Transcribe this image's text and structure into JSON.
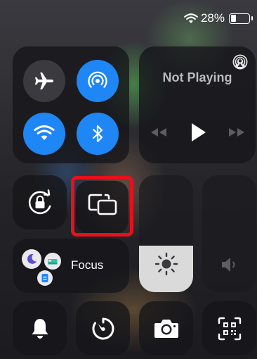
{
  "status_bar": {
    "battery_text": "28%",
    "icons": [
      "wifi-icon",
      "battery-icon"
    ]
  },
  "connectivity": {
    "airplane": {
      "icon": "airplane-icon",
      "on": false
    },
    "airdrop": {
      "icon": "airdrop-icon",
      "on": true
    },
    "wifi": {
      "icon": "wifi-icon",
      "on": true
    },
    "bluetooth": {
      "icon": "bluetooth-icon",
      "on": true
    }
  },
  "now_playing": {
    "title": "Not Playing",
    "icons": [
      "airplay-audio-icon",
      "rewind-icon",
      "play-icon",
      "fast-forward-icon"
    ]
  },
  "rotation_lock": {
    "icon": "rotation-lock-icon"
  },
  "screen_mirroring": {
    "icon": "screen-mirroring-icon",
    "highlighted": true,
    "highlight_color": "#e8101a"
  },
  "focus": {
    "label": "Focus",
    "icons": [
      "moon-icon",
      "bed-icon",
      "badge-icon"
    ]
  },
  "brightness": {
    "icon": "sun-icon",
    "level": 0.4
  },
  "volume": {
    "icon": "speaker-icon",
    "level": 0
  },
  "bottom_row": [
    {
      "name": "silent-mode",
      "icon": "bell-icon"
    },
    {
      "name": "timer",
      "icon": "timer-icon"
    },
    {
      "name": "camera",
      "icon": "camera-icon"
    },
    {
      "name": "code-scanner",
      "icon": "qr-code-icon"
    }
  ],
  "colors": {
    "accent_blue": "#1e86f5",
    "tile_bg": "#16161a",
    "gray_button": "#3b3b3f"
  }
}
